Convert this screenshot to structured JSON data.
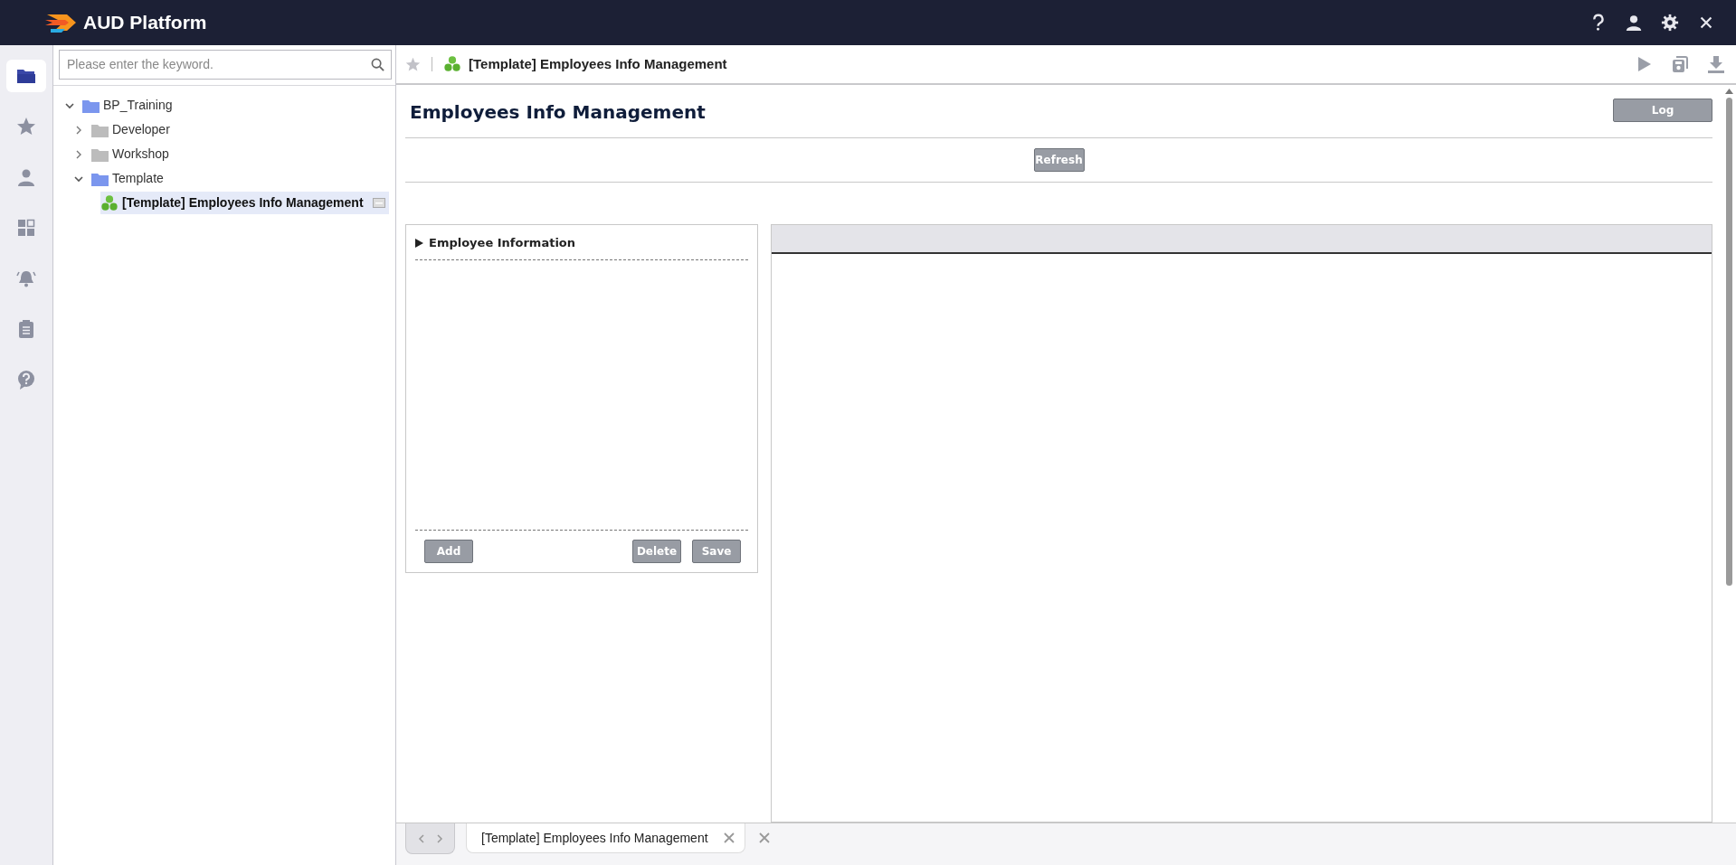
{
  "app": {
    "title": "AUD Platform"
  },
  "header_icons": [
    {
      "kind": "help"
    },
    {
      "kind": "user"
    },
    {
      "kind": "settings"
    },
    {
      "kind": "close"
    }
  ],
  "rail": [
    {
      "kind": "folder",
      "selected": true
    },
    {
      "kind": "star",
      "selected": false
    },
    {
      "kind": "user",
      "selected": false
    },
    {
      "kind": "dashboard",
      "selected": false
    },
    {
      "kind": "alarm",
      "selected": false
    },
    {
      "kind": "clipboard",
      "selected": false
    },
    {
      "kind": "help",
      "selected": false
    }
  ],
  "search": {
    "placeholder": "Please enter the keyword."
  },
  "tree": [
    {
      "label": "BP_Training",
      "kind": "folder",
      "expanded": true,
      "children": [
        {
          "label": "Developer",
          "kind": "folder",
          "expanded": false
        },
        {
          "label": "Workshop",
          "kind": "folder",
          "expanded": false
        },
        {
          "label": "Template",
          "kind": "folder",
          "expanded": true,
          "children": [
            {
              "label": "[Template] Employees Info Management",
              "kind": "report",
              "selected": true
            }
          ]
        }
      ]
    }
  ],
  "toolbar": {
    "favorite": false,
    "title": "[Template] Employees Info Management",
    "actions": [
      {
        "kind": "run"
      },
      {
        "kind": "save-as"
      },
      {
        "kind": "download"
      }
    ]
  },
  "report": {
    "title": "Employees Info Management",
    "log_button": "Log",
    "refresh_button": "Refresh",
    "panel": {
      "title": "Employee Information",
      "left_buttons": [
        {
          "label": "Add"
        }
      ],
      "right_buttons": [
        {
          "label": "Delete"
        },
        {
          "label": "Save"
        }
      ]
    }
  },
  "tabs": [
    {
      "label": "[Template] Employees Info Management",
      "selected": true
    }
  ]
}
